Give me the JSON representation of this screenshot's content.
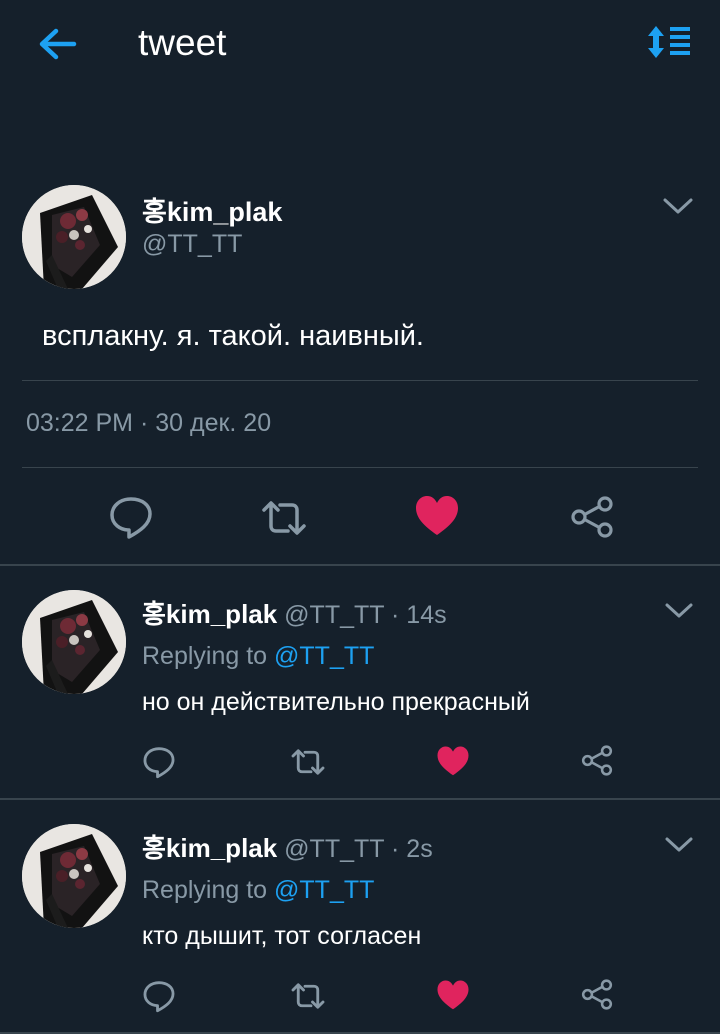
{
  "header": {
    "title": "tweet"
  },
  "main_tweet": {
    "display_name": "홍kim_plak",
    "handle": "@TT_TT",
    "text": "всплакну. я. такой. наивный.",
    "timestamp": "03:22 PM · 30 дек. 20",
    "liked": true
  },
  "replies": [
    {
      "display_name": "홍kim_plak",
      "meta": "@TT_TT · 14s",
      "replying_prefix": "Replying to",
      "replying_to": "@TT_TT",
      "text": "но он действительно прекрасный",
      "liked": true
    },
    {
      "display_name": "홍kim_plak",
      "meta": "@TT_TT · 2s",
      "replying_prefix": "Replying to",
      "replying_to": "@TT_TT",
      "text": "кто дышит, тот согласен",
      "liked": true
    }
  ],
  "colors": {
    "background": "#15202b",
    "accent": "#1da1f2",
    "like": "#e0245e",
    "secondary_text": "#8899a6",
    "divider": "#38444d"
  },
  "icons": [
    "back-arrow-icon",
    "sort-icon",
    "chevron-down-icon",
    "reply-icon",
    "retweet-icon",
    "heart-icon",
    "share-icon"
  ]
}
